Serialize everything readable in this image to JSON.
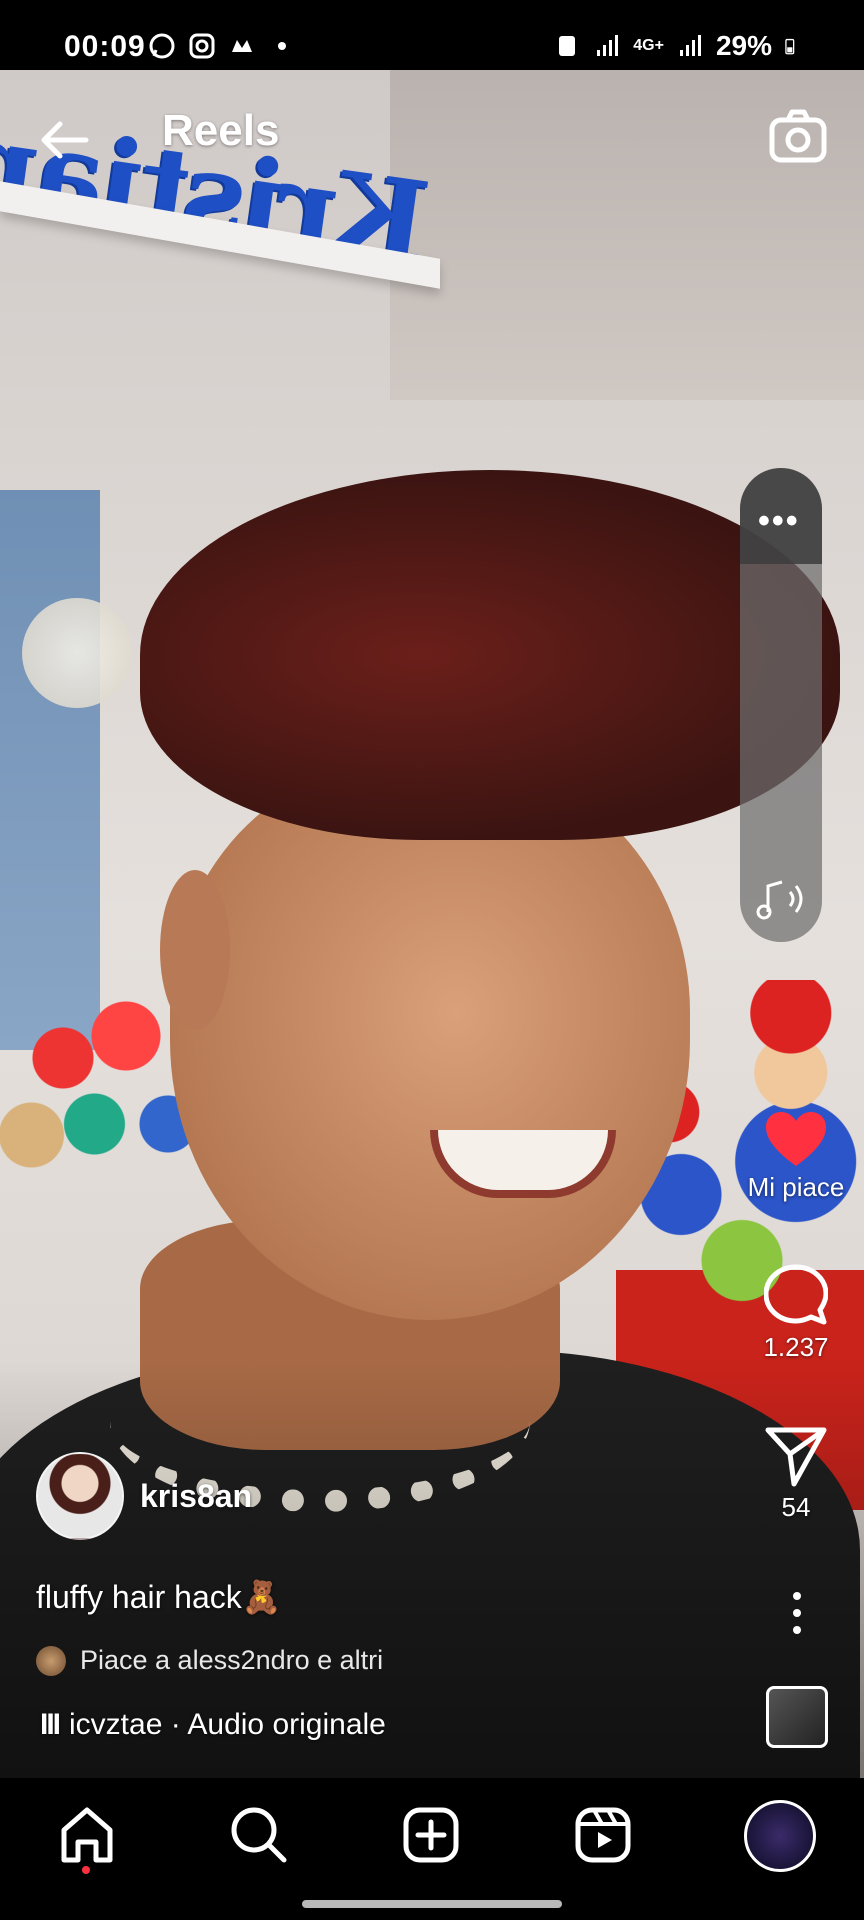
{
  "status_bar": {
    "time": "00:09",
    "network_label": "4G+",
    "battery": "29%"
  },
  "header": {
    "title": "Reels",
    "back_icon": "arrow-left-icon",
    "camera_icon": "camera-icon"
  },
  "side_panel": {
    "more_label": "•••",
    "music_icon": "music-volume-icon"
  },
  "actions": {
    "like_label": "Mi piace",
    "comment_count": "1.237",
    "share_count": "54"
  },
  "post": {
    "author": "kris8an",
    "caption": "fluffy hair hack🧸",
    "liked_by": "Piace a aless2ndro e altri",
    "audio_bars": "III",
    "audio_label": "icvztae · Audio originale"
  },
  "bottom_nav": {
    "items": [
      "home-icon",
      "search-icon",
      "create-icon",
      "reels-icon",
      "profile-avatar"
    ]
  },
  "colors": {
    "like_red": "#ff3040",
    "sign_blue": "#1f4fc5"
  }
}
